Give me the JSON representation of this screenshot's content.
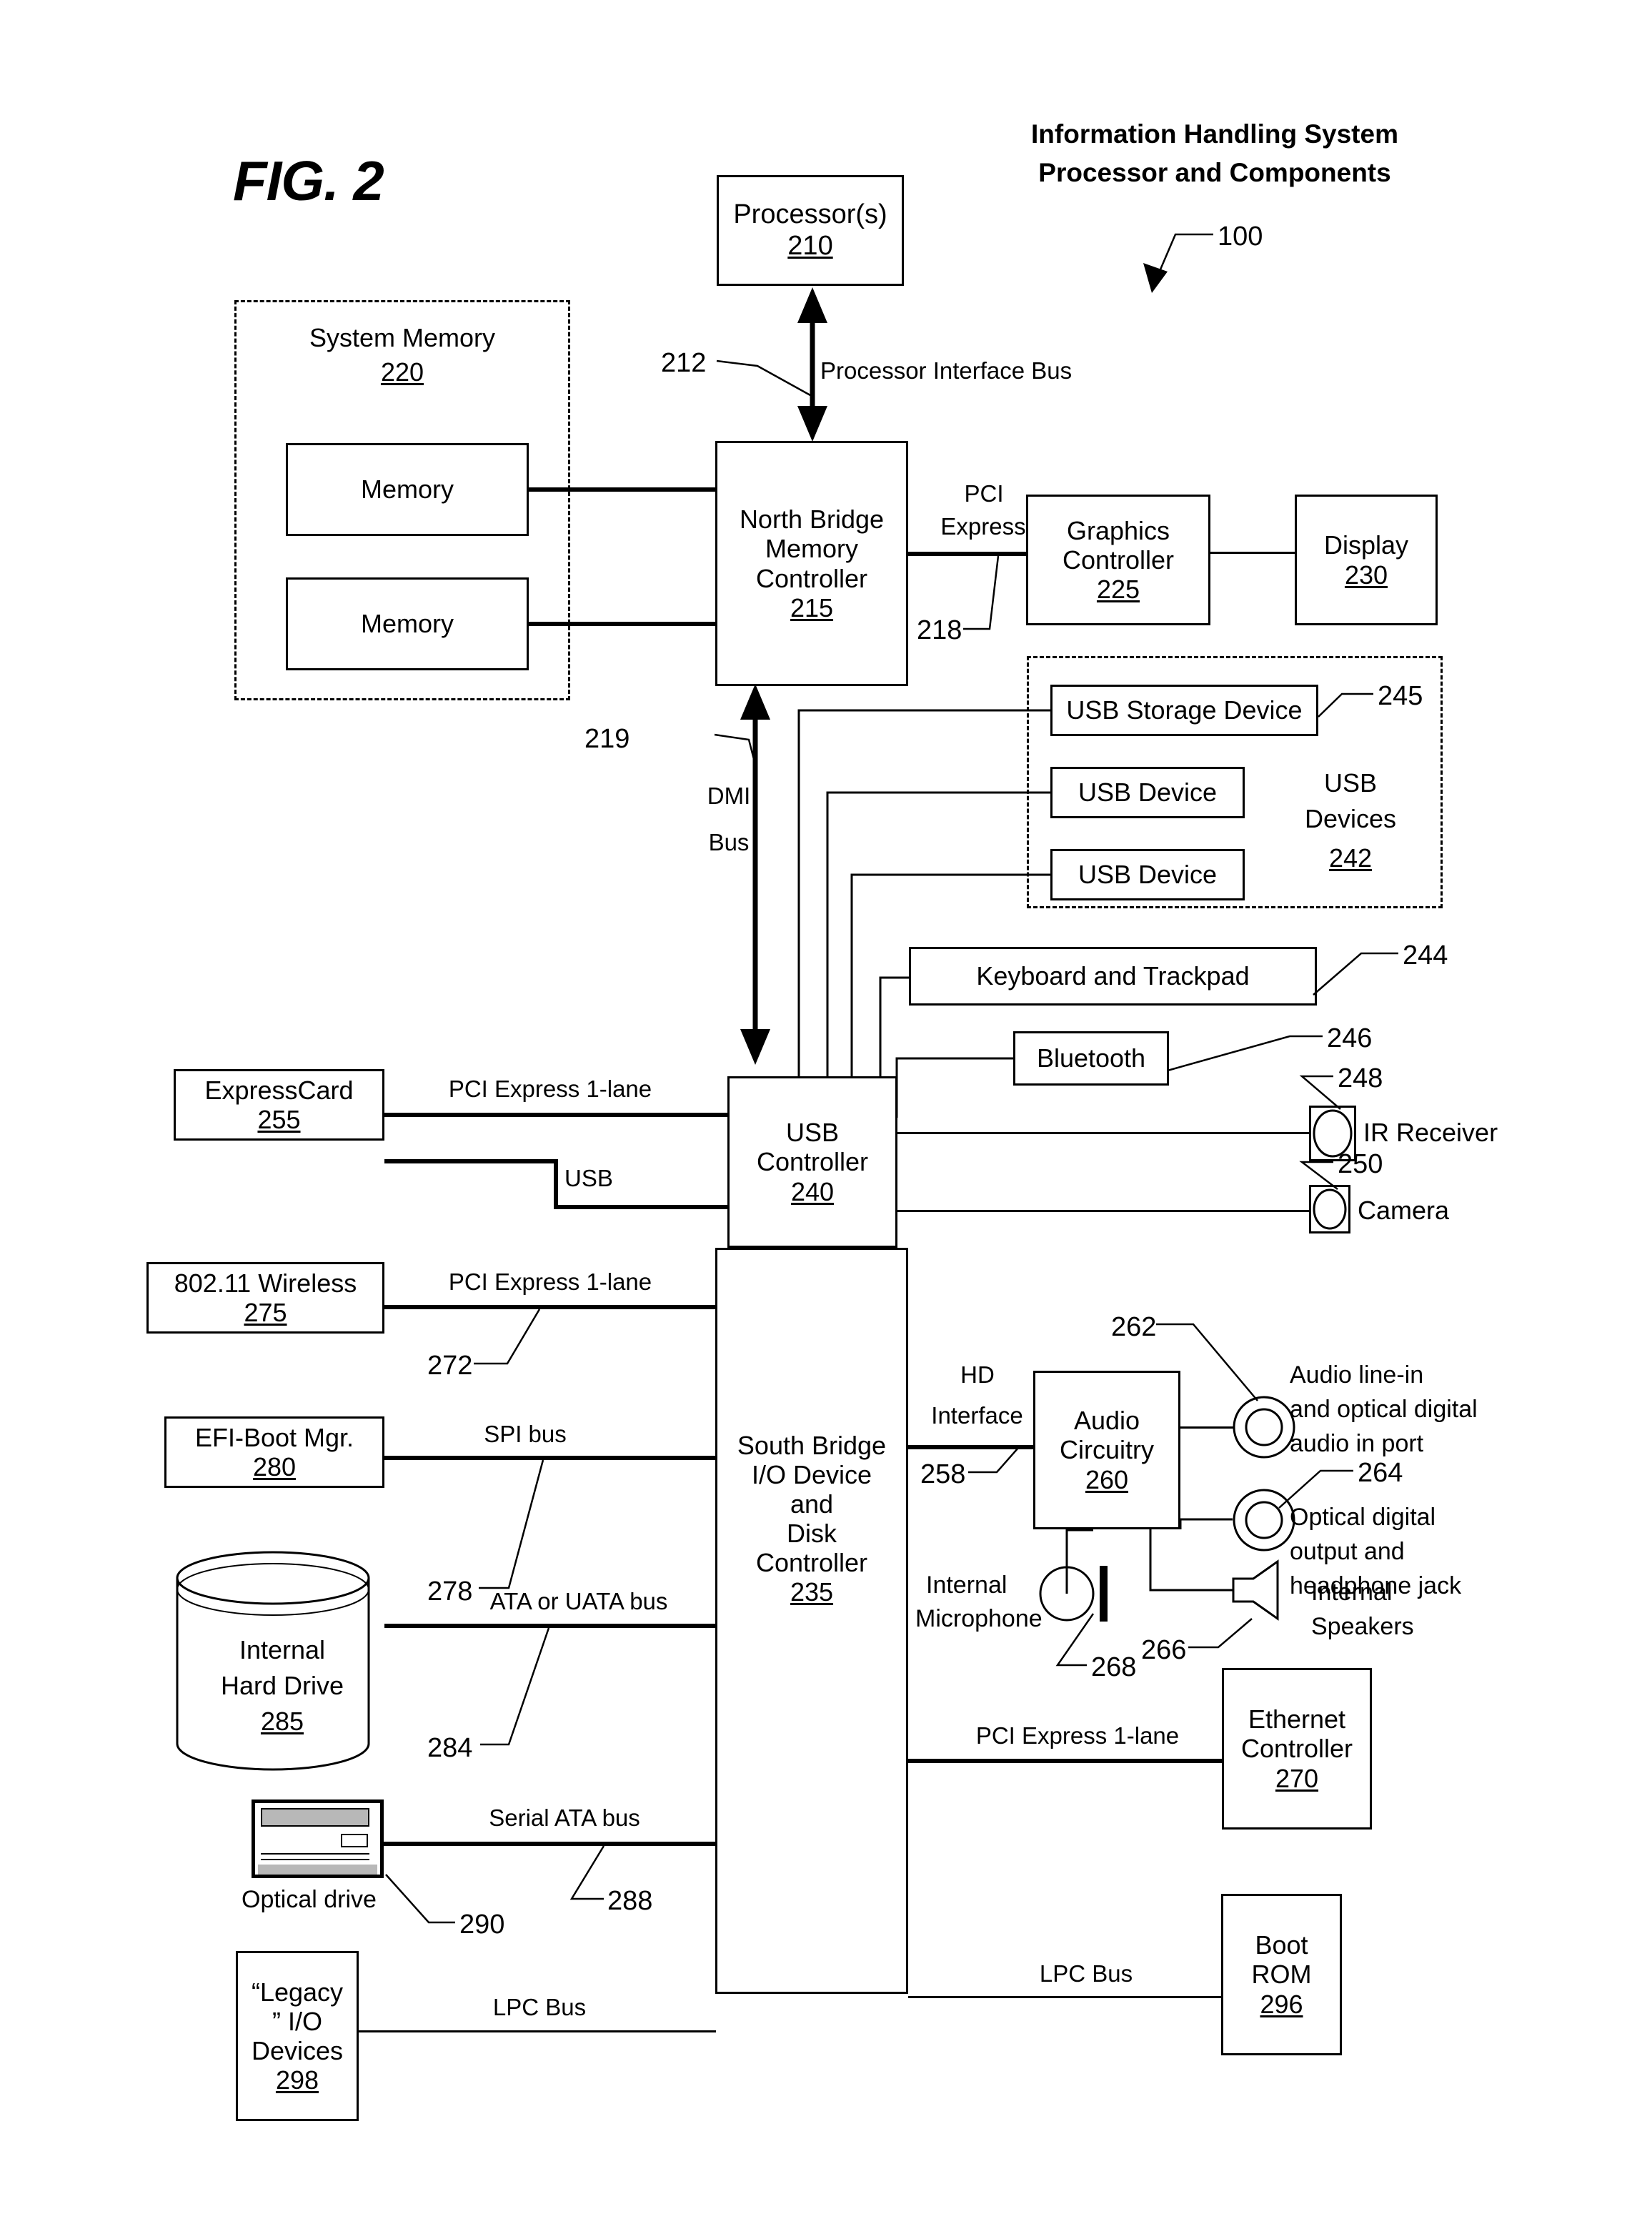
{
  "figure": {
    "label": "FIG. 2",
    "header_line1": "Information Handling System",
    "header_line2": "Processor and Components",
    "system_ref": "100"
  },
  "blocks": {
    "processor": {
      "title": "Processor(s)",
      "ref": "210"
    },
    "system_memory": {
      "title": "System Memory",
      "ref": "220"
    },
    "memory_1": {
      "title": "Memory"
    },
    "memory_2": {
      "title": "Memory"
    },
    "north_bridge": {
      "line1": "North Bridge",
      "line2": "Memory",
      "line3": "Controller",
      "ref": "215"
    },
    "graphics": {
      "line1": "Graphics",
      "line2": "Controller",
      "ref": "225"
    },
    "display": {
      "title": "Display",
      "ref": "230"
    },
    "usb_devices_group": {
      "line1": "USB",
      "line2": "Devices",
      "ref": "242"
    },
    "usb_storage": {
      "title": "USB Storage Device"
    },
    "usb_device_1": {
      "title": "USB Device"
    },
    "usb_device_2": {
      "title": "USB Device"
    },
    "keyboard": {
      "title": "Keyboard and Trackpad"
    },
    "bluetooth": {
      "title": "Bluetooth"
    },
    "ir_receiver": {
      "title": "IR Receiver"
    },
    "camera": {
      "title": "Camera"
    },
    "usb_controller": {
      "line1": "USB",
      "line2": "Controller",
      "ref": "240"
    },
    "expresscard": {
      "title": "ExpressCard",
      "ref": "255"
    },
    "wireless": {
      "title": "802.11 Wireless",
      "ref": "275"
    },
    "efi_boot": {
      "title": "EFI-Boot Mgr.",
      "ref": "280"
    },
    "hard_drive": {
      "line1": "Internal",
      "line2": "Hard Drive",
      "ref": "285"
    },
    "optical_drive": {
      "title": "Optical drive"
    },
    "legacy_io": {
      "line1": "“Legacy",
      "line2": "” I/O",
      "line3": "Devices",
      "ref": "298"
    },
    "south_bridge": {
      "line1": "South Bridge",
      "line2": "I/O Device",
      "line3": "and",
      "line4": "Disk",
      "line5": "Controller",
      "ref": "235"
    },
    "audio": {
      "line1": "Audio",
      "line2": "Circuitry",
      "ref": "260"
    },
    "audio_in_port": {
      "line1": "Audio line-in",
      "line2": "and optical digital",
      "line3": "audio in port"
    },
    "audio_out_jack": {
      "line1": "Optical digital",
      "line2": "output and",
      "line3": "headphone jack"
    },
    "internal_mic": {
      "line1": "Internal",
      "line2": "Microphone"
    },
    "internal_speakers": {
      "line1": "Internal",
      "line2": "Speakers"
    },
    "ethernet": {
      "line1": "Ethernet",
      "line2": "Controller",
      "ref": "270"
    },
    "boot_rom": {
      "line1": "Boot",
      "line2": "ROM",
      "ref": "296"
    }
  },
  "buses": {
    "processor_interface": "Processor Interface Bus",
    "pci_express_gfx_l1": "PCI",
    "pci_express_gfx_l2": "Express",
    "dmi_l1": "DMI",
    "dmi_l2": "Bus",
    "pcie_1lane_express": "PCI Express 1-lane",
    "usb": "USB",
    "pcie_1lane_wireless": "PCI Express 1-lane",
    "spi": "SPI bus",
    "ata": "ATA or UATA bus",
    "serial_ata": "Serial ATA bus",
    "lpc_left": "LPC Bus",
    "lpc_right": "LPC Bus",
    "hd_interface_l1": "HD",
    "hd_interface_l2": "Interface",
    "pcie_1lane_ethernet": "PCI Express 1-lane"
  },
  "refs": {
    "r212": "212",
    "r218": "218",
    "r219": "219",
    "r244": "244",
    "r245": "245",
    "r246": "246",
    "r248": "248",
    "r250": "250",
    "r258": "258",
    "r262": "262",
    "r264": "264",
    "r266": "266",
    "r268": "268",
    "r272": "272",
    "r278": "278",
    "r284": "284",
    "r288": "288",
    "r290": "290"
  },
  "colors": {
    "ink": "#000000",
    "paper": "#ffffff",
    "icon_fill": "#b8b8b8"
  }
}
